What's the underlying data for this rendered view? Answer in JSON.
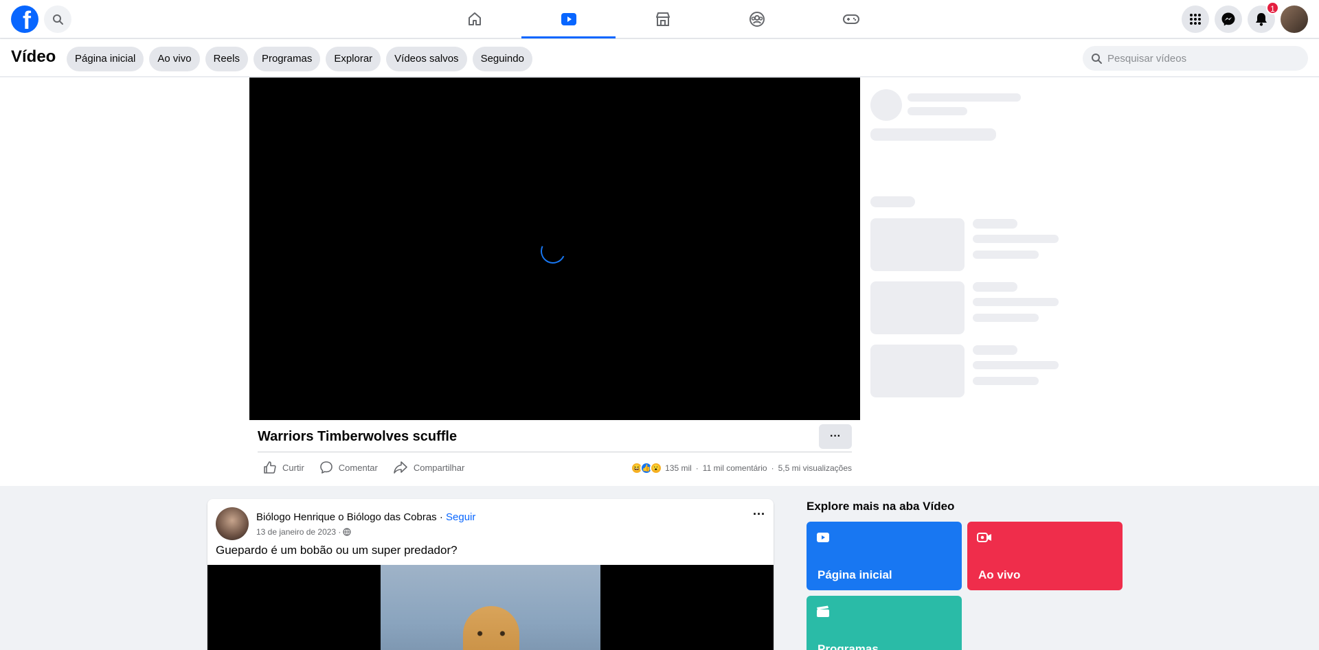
{
  "nav": {
    "logo": "f",
    "tabs": [
      {
        "name": "home",
        "icon": "home-icon",
        "active": false
      },
      {
        "name": "video",
        "icon": "video-icon",
        "active": true
      },
      {
        "name": "marketplace",
        "icon": "marketplace-icon",
        "active": false
      },
      {
        "name": "groups",
        "icon": "groups-icon",
        "active": false
      },
      {
        "name": "gaming",
        "icon": "gaming-icon",
        "active": false
      }
    ],
    "notification_count": "1"
  },
  "subheader": {
    "title": "Vídeo",
    "chips": [
      "Página inicial",
      "Ao vivo",
      "Reels",
      "Programas",
      "Explorar",
      "Vídeos salvos",
      "Seguindo"
    ],
    "search_placeholder": "Pesquisar vídeos"
  },
  "video": {
    "title": "Warriors Timberwolves scuffle",
    "more_label": "···",
    "actions": {
      "like": "Curtir",
      "comment": "Comentar",
      "share": "Compartilhar"
    },
    "reactions_count": "135 mil",
    "comments": "11 mil comentário",
    "views": "5,5 mi visualizações",
    "separator": "·"
  },
  "post": {
    "author": "Biólogo Henrique o Biólogo das Cobras",
    "follow": "Seguir",
    "dot": " · ",
    "date": "13 de janeiro de 2023 ·",
    "more": "···",
    "title": "Guepardo é um bobão ou um super predador?"
  },
  "explore": {
    "title": "Explore mais na aba Vídeo",
    "tiles": [
      {
        "label": "Página inicial",
        "color": "#1877f2"
      },
      {
        "label": "Ao vivo",
        "color": "#ef2d4b"
      },
      {
        "label": "Programas",
        "color": "#2abba7"
      }
    ]
  },
  "colors": {
    "brand": "#0866ff",
    "background": "#f0f2f5"
  }
}
